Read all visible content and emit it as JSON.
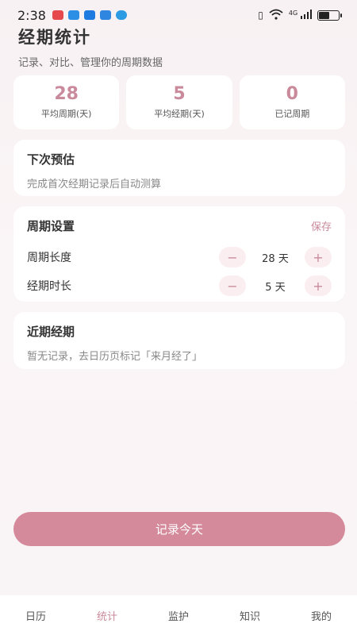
{
  "status_bar": {
    "time": "2:38",
    "network": "4G",
    "battery_level": 0.55,
    "app_icon_colors": [
      "#e5484d",
      "#2b8fe6",
      "#1f7be0",
      "#2f86e0",
      "#2c9be3"
    ]
  },
  "header": {
    "title": "经期统计",
    "subtitle": "记录、对比、管理你的周期数据"
  },
  "stats": [
    {
      "value": "28",
      "label": "平均周期(天)"
    },
    {
      "value": "5",
      "label": "平均经期(天)"
    },
    {
      "value": "0",
      "label": "已记周期"
    }
  ],
  "next_prediction": {
    "title": "下次预估",
    "description": "完成首次经期记录后自动测算"
  },
  "cycle_settings": {
    "title": "周期设置",
    "save_label": "保存",
    "decrement_symbol": "−",
    "increment_symbol": "+",
    "rows": [
      {
        "label": "周期长度",
        "value": "28 天"
      },
      {
        "label": "经期时长",
        "value": "5 天"
      }
    ]
  },
  "recent_periods": {
    "title": "近期经期",
    "description": "暂无记录，去日历页标记「来月经了」"
  },
  "record_button": {
    "label": "记录今天"
  },
  "tabbar": {
    "tabs": [
      {
        "label": "日历",
        "active": false
      },
      {
        "label": "统计",
        "active": true
      },
      {
        "label": "监护",
        "active": false
      },
      {
        "label": "知识",
        "active": false
      },
      {
        "label": "我的",
        "active": false
      }
    ]
  },
  "colors": {
    "accent": "#c98a9b",
    "primary_button": "#d48a9a",
    "stepper_bg": "#fbeef1"
  }
}
